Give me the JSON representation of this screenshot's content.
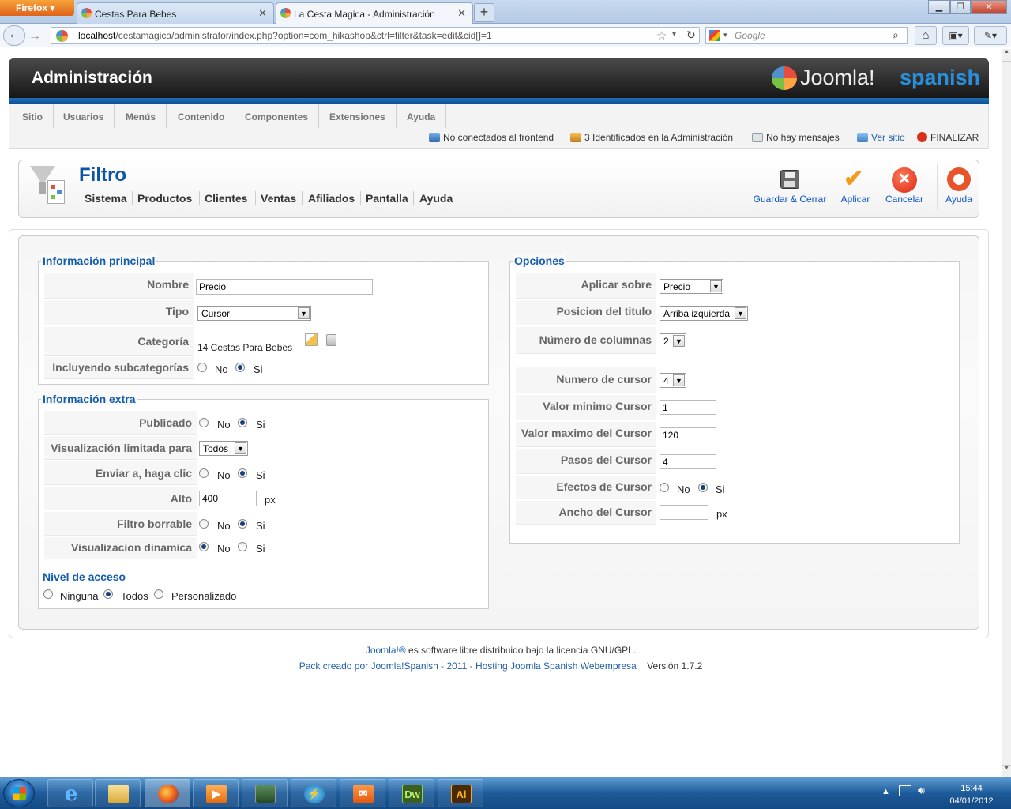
{
  "browser": {
    "app_button": "Firefox",
    "tabs": [
      {
        "label": "Cestas Para Bebes"
      },
      {
        "label": "La Cesta Magica - Administración"
      }
    ],
    "url_host": "localhost",
    "url_path": "/cestamagica/administrator/index.php?option=com_hikashop&ctrl=filter&task=edit&cid[]=1",
    "search_placeholder": "Google"
  },
  "header": {
    "title": "Administración",
    "logo_text": "Joomla!",
    "logo_sub": "spanish"
  },
  "menu": [
    "Sitio",
    "Usuarios",
    "Menús",
    "Contenido",
    "Componentes",
    "Extensiones",
    "Ayuda"
  ],
  "status": {
    "frontend": "No conectados al frontend",
    "admins": "3 Identificados en la Administración",
    "messages": "No hay mensajes",
    "view_site": "Ver sitio",
    "logout": "FINALIZAR"
  },
  "toolbar": {
    "page_title": "Filtro",
    "submenu": [
      "Sistema",
      "Productos",
      "Clientes",
      "Ventas",
      "Afiliados",
      "Pantalla",
      "Ayuda"
    ],
    "buttons": {
      "save_close": "Guardar & Cerrar",
      "apply": "Aplicar",
      "cancel": "Cancelar",
      "help": "Ayuda"
    }
  },
  "main_info": {
    "legend": "Información principal",
    "nombre_label": "Nombre",
    "nombre_value": "Precio",
    "tipo_label": "Tipo",
    "tipo_value": "Cursor",
    "categoria_label": "Categoría",
    "categoria_value": "14 Cestas Para Bebes",
    "subcat_label": "Incluyendo subcategorías",
    "no": "No",
    "si": "Si"
  },
  "extra_info": {
    "legend": "Información extra",
    "publicado_label": "Publicado",
    "visual_label": "Visualización limitada para",
    "visual_value": "Todos",
    "enviar_label": "Enviar a, haga clic",
    "alto_label": "Alto",
    "alto_value": "400",
    "alto_unit": "px",
    "borrable_label": "Filtro borrable",
    "dinamica_label": "Visualizacion dinamica",
    "acceso_title": "Nivel de acceso",
    "acceso_options": [
      "Ninguna",
      "Todos",
      "Personalizado"
    ]
  },
  "options": {
    "legend": "Opciones",
    "aplicar_label": "Aplicar sobre",
    "aplicar_value": "Precio",
    "posicion_label": "Posicion del titulo",
    "posicion_value": "Arriba izquierda",
    "columnas_label": "Número de columnas",
    "columnas_value": "2",
    "cursor_label": "Numero de cursor",
    "cursor_value": "4",
    "min_label": "Valor minimo Cursor",
    "min_value": "1",
    "max_label": "Valor maximo del Cursor",
    "max_value": "120",
    "pasos_label": "Pasos del Cursor",
    "pasos_value": "4",
    "efectos_label": "Efectos de Cursor",
    "ancho_label": "Ancho del Cursor",
    "ancho_value": "",
    "ancho_unit": "px"
  },
  "footer": {
    "joomla_link": "Joomla!®",
    "license_text": "es software libre distribuido bajo la licencia GNU/GPL.",
    "pack_link": "Pack creado por Joomla!Spanish - 2011 - Hosting Joomla Spanish Webempresa",
    "version": "Versión 1.7.2"
  },
  "taskbar": {
    "dw_label": "Dw",
    "ai_label": "Ai",
    "time": "15:44",
    "date": "04/01/2012"
  }
}
